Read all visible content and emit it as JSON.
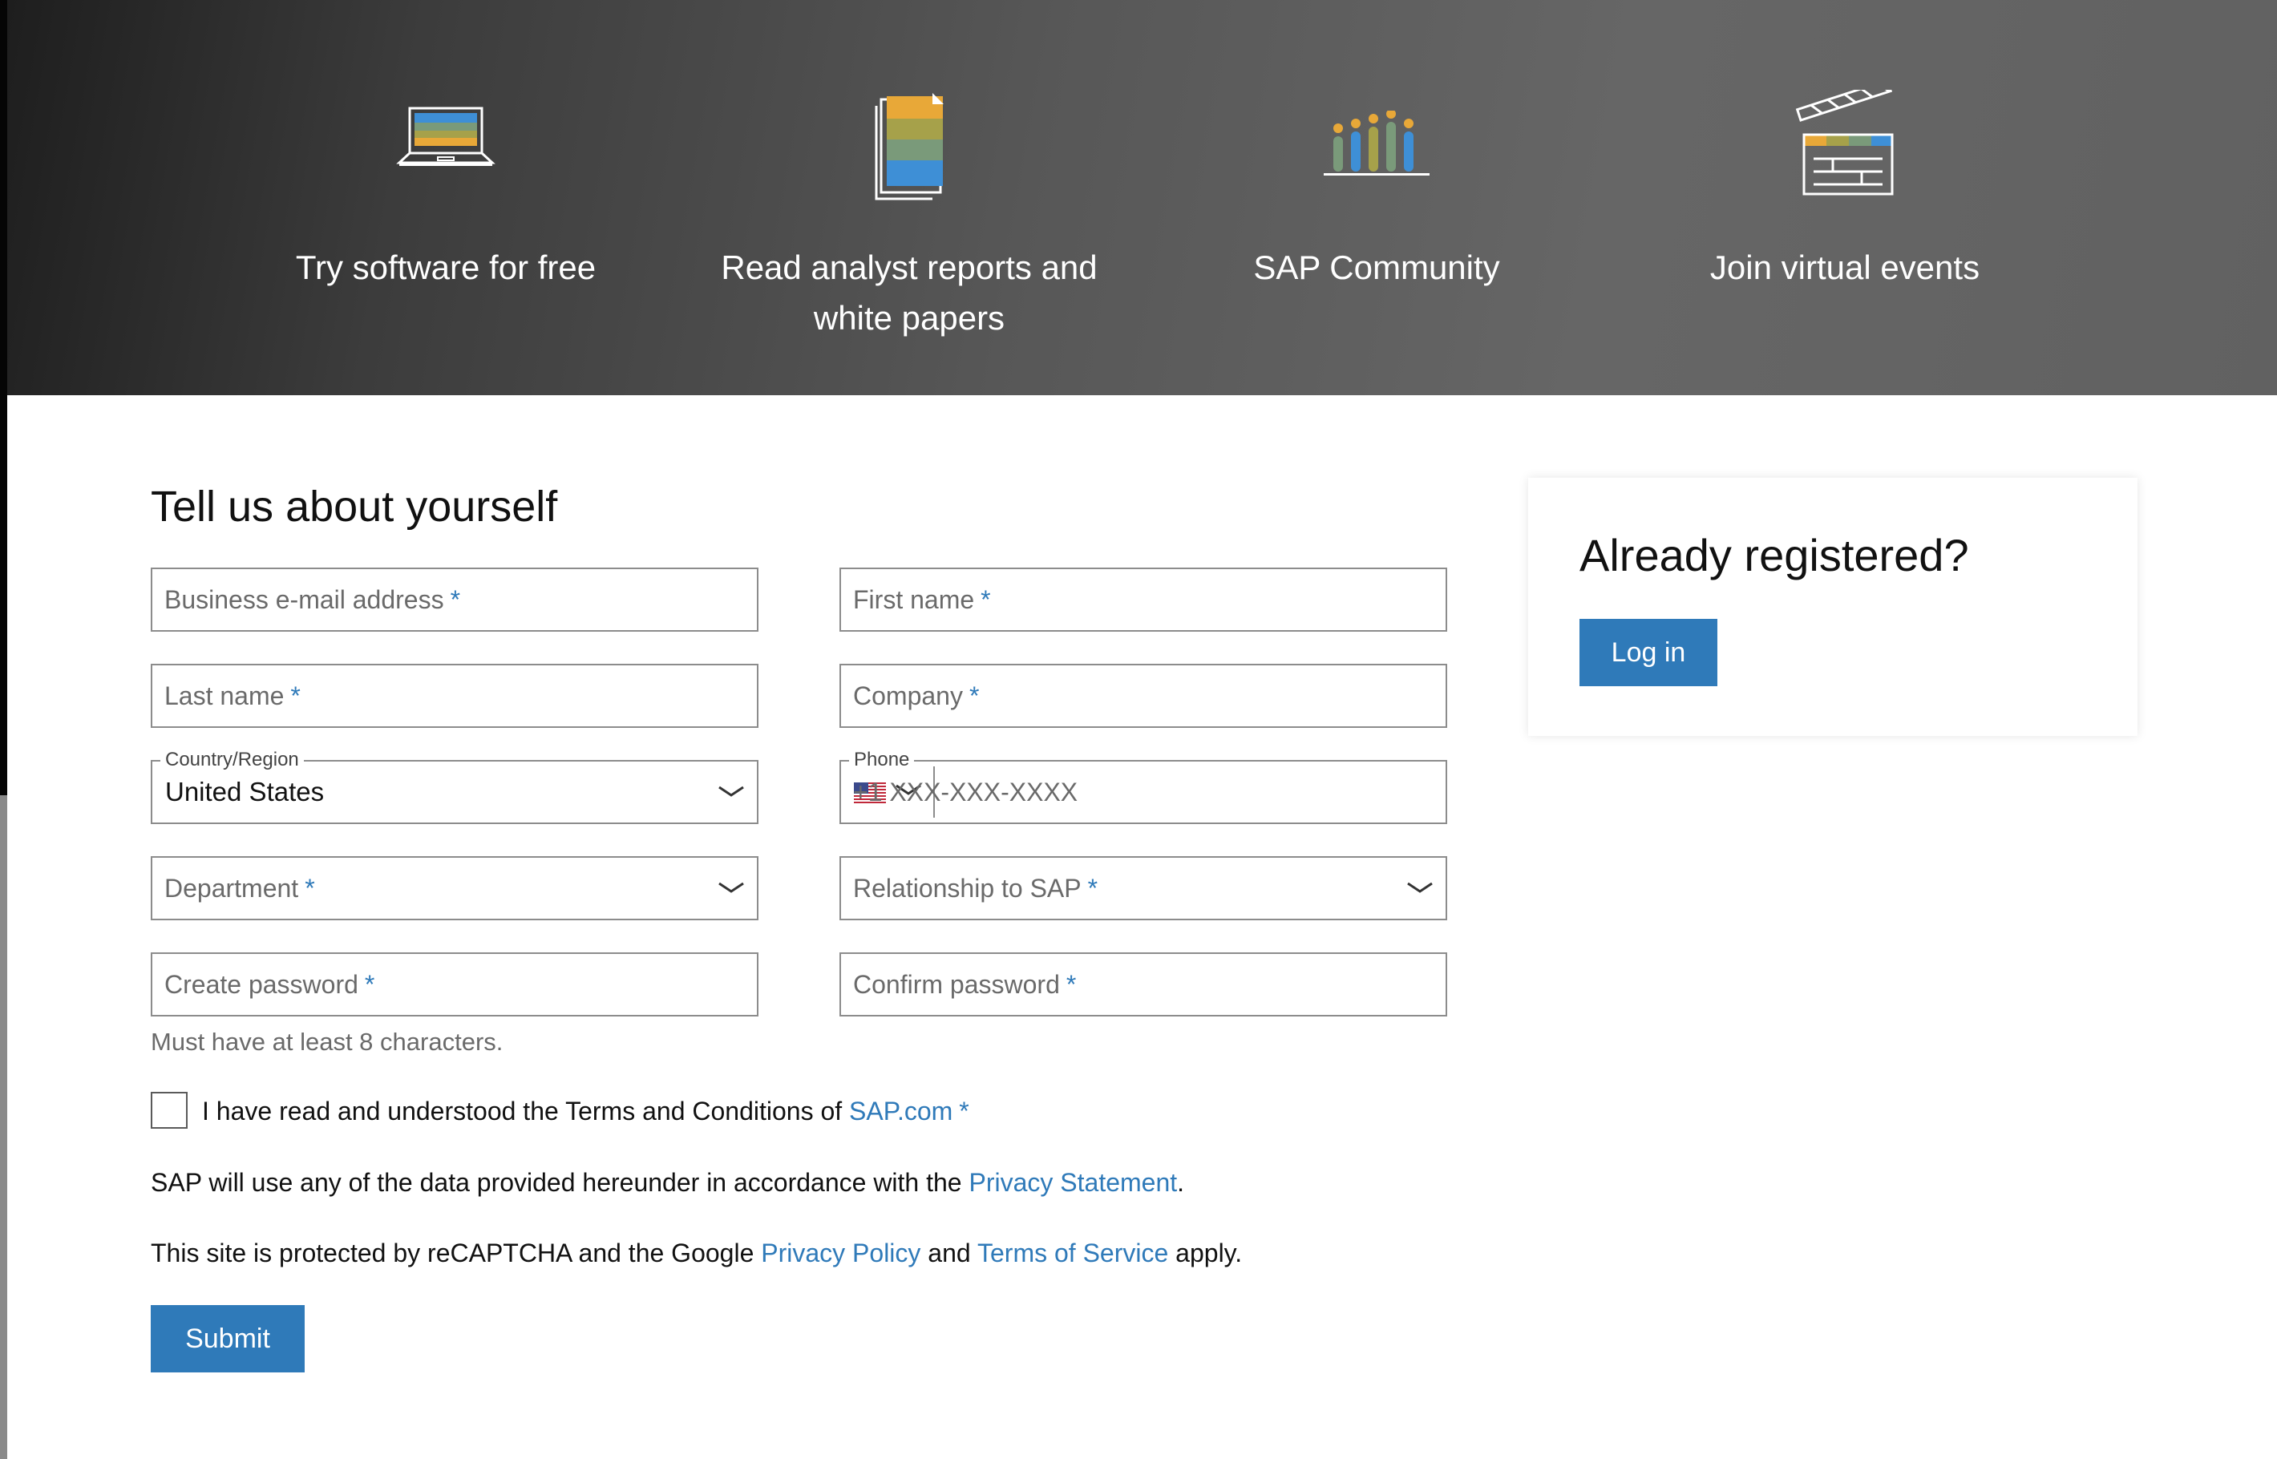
{
  "hero": {
    "items": [
      {
        "icon": "laptop-icon",
        "label": "Try software for free"
      },
      {
        "icon": "documents-icon",
        "label_line1": "Read analyst reports and",
        "label_line2": "white papers"
      },
      {
        "icon": "community-icon",
        "label": "SAP Community"
      },
      {
        "icon": "clapperboard-icon",
        "label": "Join virtual events"
      }
    ],
    "icon_colors": [
      "#e8a838",
      "#a6a14a",
      "#7a9a7a",
      "#3e8fd6"
    ]
  },
  "form": {
    "title": "Tell us about yourself",
    "required_marker": "*",
    "email": {
      "placeholder": "Business e-mail address"
    },
    "first_name": {
      "placeholder": "First name"
    },
    "last_name": {
      "placeholder": "Last name"
    },
    "company": {
      "placeholder": "Company"
    },
    "country": {
      "label": "Country/Region",
      "value": "United States"
    },
    "phone": {
      "label": "Phone",
      "placeholder": "+1 XXX-XXX-XXXX",
      "flag": "us-flag-icon"
    },
    "department": {
      "placeholder": "Department"
    },
    "relationship": {
      "placeholder": "Relationship to SAP"
    },
    "password": {
      "placeholder": "Create password",
      "hint": "Must have at least 8 characters."
    },
    "confirm_password": {
      "placeholder": "Confirm password"
    },
    "terms": {
      "text": "I have read and understood the Terms and Conditions of ",
      "link": "SAP.com"
    },
    "privacy": {
      "text_before": "SAP will use any of the data provided hereunder in accordance with the ",
      "link": "Privacy Statement",
      "text_after": "."
    },
    "recaptcha": {
      "text_before": "This site is protected by reCAPTCHA and the Google ",
      "link1": "Privacy Policy",
      "middle": " and ",
      "link2": "Terms of Service",
      "text_after": " apply."
    },
    "submit_label": "Submit"
  },
  "login_card": {
    "title": "Already registered?",
    "button_label": "Log in"
  },
  "colors": {
    "accent": "#2f7ab9",
    "hero_dark": "#1e1e1e",
    "hero_light": "#666666"
  }
}
